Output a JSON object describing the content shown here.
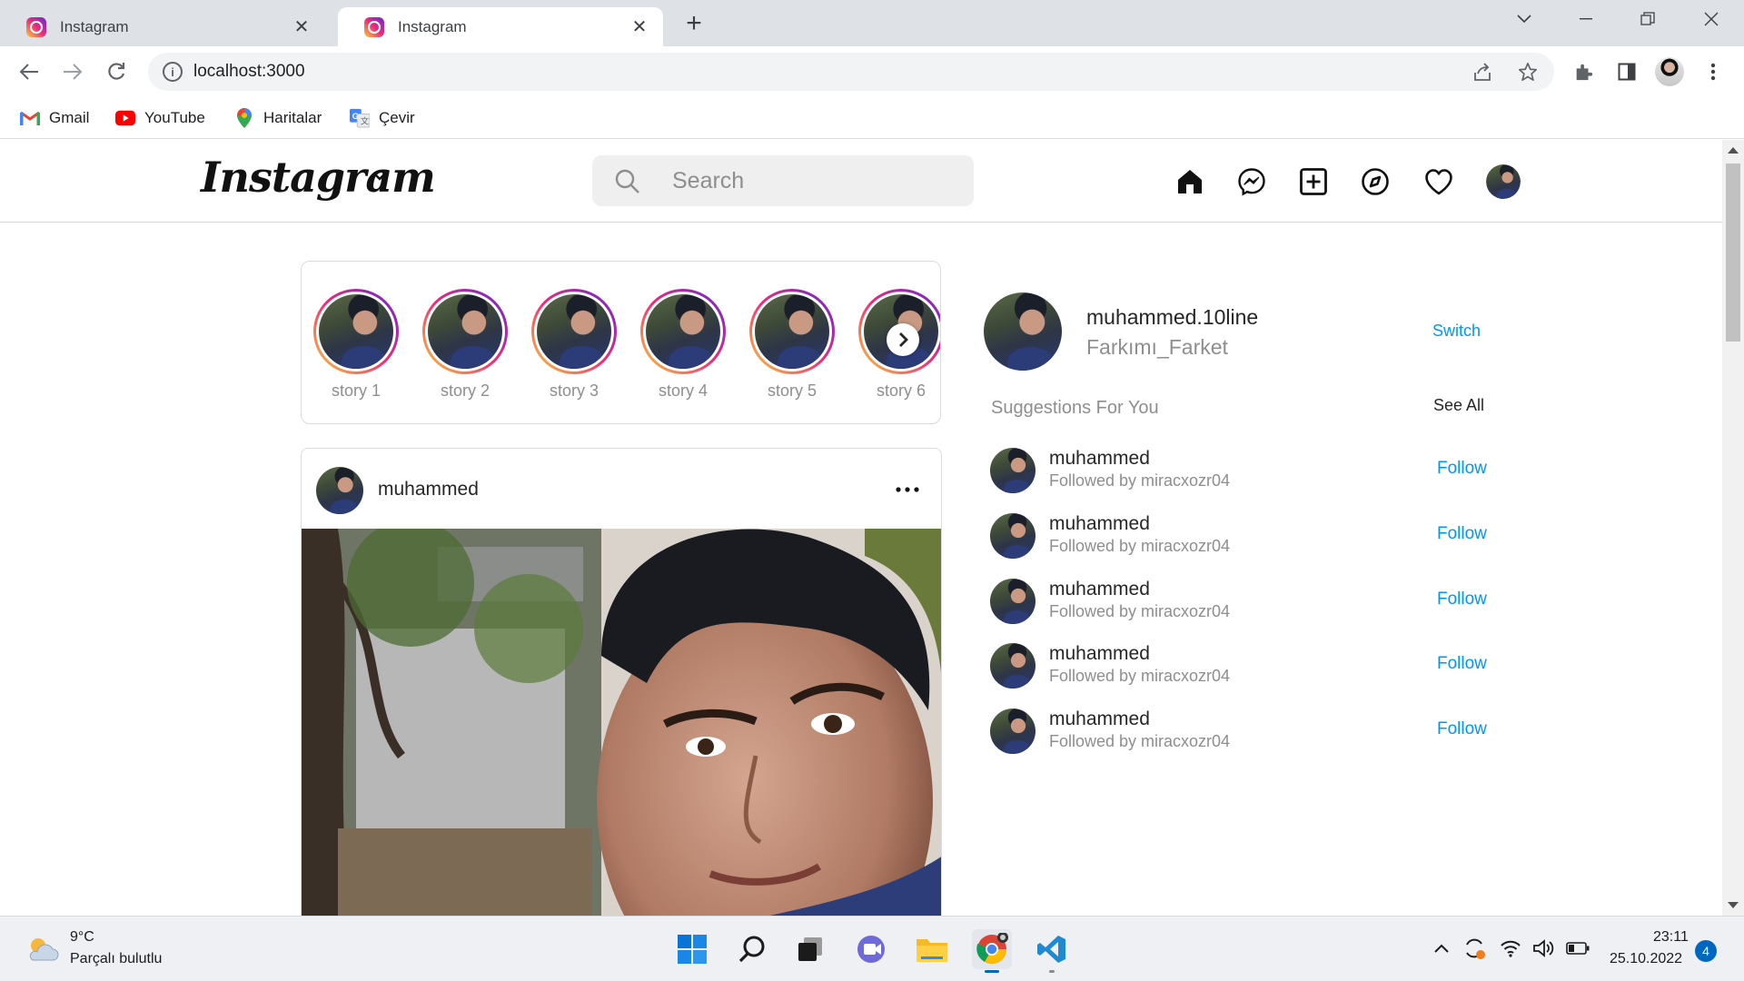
{
  "browser": {
    "tabs": [
      {
        "title": "Instagram",
        "close": "✕"
      },
      {
        "title": "Instagram",
        "close": "✕"
      }
    ],
    "new_tab": "+",
    "address": "localhost:3000",
    "bookmarks": [
      {
        "label": "Gmail",
        "icon": "gmail-icon"
      },
      {
        "label": "YouTube",
        "icon": "youtube-icon"
      },
      {
        "label": "Haritalar",
        "icon": "maps-icon"
      },
      {
        "label": "Çevir",
        "icon": "translate-icon"
      }
    ]
  },
  "instagram": {
    "logo": "Instagram",
    "search_placeholder": "Search",
    "nav_icons": [
      "home-icon",
      "messenger-icon",
      "new-post-icon",
      "explore-icon",
      "activity-heart-icon",
      "profile-avatar"
    ],
    "stories": [
      "story 1",
      "story 2",
      "story 3",
      "story 4",
      "story 5",
      "story 6"
    ],
    "post": {
      "username": "muhammed",
      "more": "•••"
    },
    "sidebar": {
      "username": "muhammed.10line",
      "name": "Farkımı_Farket",
      "switch_label": "Switch",
      "suggestions_title": "Suggestions For You",
      "see_all": "See All",
      "suggestions": [
        {
          "username": "muhammed",
          "subtitle": "Followed by miracxozr04",
          "action": "Follow"
        },
        {
          "username": "muhammed",
          "subtitle": "Followed by miracxozr04",
          "action": "Follow"
        },
        {
          "username": "muhammed",
          "subtitle": "Followed by miracxozr04",
          "action": "Follow"
        },
        {
          "username": "muhammed",
          "subtitle": "Followed by miracxozr04",
          "action": "Follow"
        },
        {
          "username": "muhammed",
          "subtitle": "Followed by miracxozr04",
          "action": "Follow"
        }
      ]
    }
  },
  "taskbar": {
    "weather_temp": "9°C",
    "weather_desc": "Parçalı bulutlu",
    "time": "23:11",
    "date": "25.10.2022",
    "notification_count": "4"
  },
  "colors": {
    "accent_blue": "#0095f6",
    "story_ring": [
      "#f9ce34",
      "#ee2a7b",
      "#6228d7"
    ]
  }
}
